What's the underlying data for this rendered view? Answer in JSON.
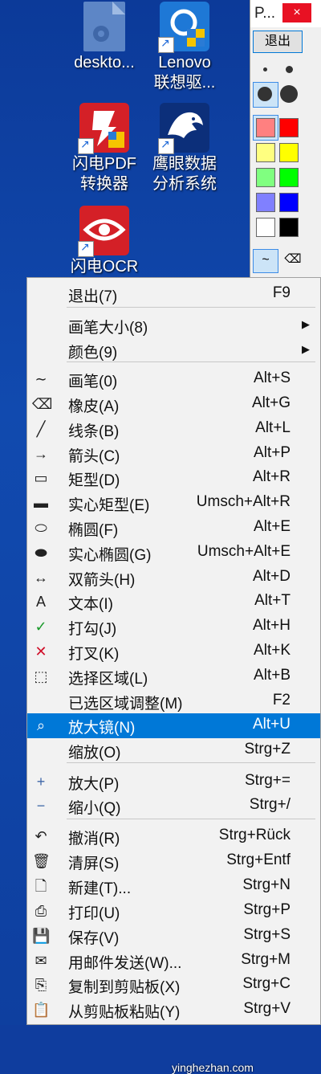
{
  "desktop_icons": [
    {
      "label_lines": [
        "deskto..."
      ],
      "icon": "config-file-icon"
    },
    {
      "label_lines": [
        "Lenovo",
        "联想驱..."
      ],
      "icon": "lenovo-driver-icon"
    },
    {
      "label_lines": [
        "闪电PDF",
        "转换器"
      ],
      "icon": "pdf-converter-icon"
    },
    {
      "label_lines": [
        "鹰眼数据",
        "分析系统"
      ],
      "icon": "eagle-icon"
    },
    {
      "label_lines": [
        "闪电OCR"
      ],
      "icon": "ocr-eye-icon"
    }
  ],
  "toolbar": {
    "title": "P...",
    "close_glyph": "×",
    "exit_label": "退出",
    "colors": [
      "#ff8080",
      "#ff0000",
      "#ffff80",
      "#ffff00",
      "#80ff80",
      "#00ff00",
      "#8080ff",
      "#0000ff",
      "#ffffff",
      "#000000"
    ]
  },
  "menu": {
    "items": [
      {
        "label": "退出(7)",
        "shortcut": "F9",
        "icon": ""
      },
      {
        "label": "画笔大小(8)",
        "shortcut": "",
        "submenu": true,
        "icon": ""
      },
      {
        "label": "颜色(9)",
        "shortcut": "",
        "submenu": true,
        "icon": ""
      },
      {
        "label": "画笔(0)",
        "shortcut": "Alt+S",
        "icon": "pen-icon"
      },
      {
        "label": "橡皮(A)",
        "shortcut": "Alt+G",
        "icon": "eraser-icon"
      },
      {
        "label": "线条(B)",
        "shortcut": "Alt+L",
        "icon": "line-icon"
      },
      {
        "label": "箭头(C)",
        "shortcut": "Alt+P",
        "icon": "arrow-icon"
      },
      {
        "label": "矩型(D)",
        "shortcut": "Alt+R",
        "icon": "rectangle-icon"
      },
      {
        "label": "实心矩型(E)",
        "shortcut": "Umsch+Alt+R",
        "icon": "filled-rectangle-icon"
      },
      {
        "label": "椭圆(F)",
        "shortcut": "Alt+E",
        "icon": "ellipse-icon"
      },
      {
        "label": "实心椭圆(G)",
        "shortcut": "Umsch+Alt+E",
        "icon": "filled-ellipse-icon"
      },
      {
        "label": "双箭头(H)",
        "shortcut": "Alt+D",
        "icon": "double-arrow-icon"
      },
      {
        "label": "文本(I)",
        "shortcut": "Alt+T",
        "icon": "text-icon"
      },
      {
        "label": "打勾(J)",
        "shortcut": "Alt+H",
        "icon": "checkmark-icon"
      },
      {
        "label": "打叉(K)",
        "shortcut": "Alt+K",
        "icon": "cross-icon"
      },
      {
        "label": "选择区域(L)",
        "shortcut": "Alt+B",
        "icon": "select-area-icon"
      },
      {
        "label": "已选区域调整(M)",
        "shortcut": "F2",
        "icon": ""
      },
      {
        "label": "放大镜(N)",
        "shortcut": "Alt+U",
        "icon": "magnifier-icon",
        "highlighted": true
      },
      {
        "label": "缩放(O)",
        "shortcut": "Strg+Z",
        "icon": ""
      },
      {
        "label": "放大(P)",
        "shortcut": "Strg+=",
        "icon": "plus-icon"
      },
      {
        "label": "缩小(Q)",
        "shortcut": "Strg+/",
        "icon": "minus-icon"
      },
      {
        "label": "撤消(R)",
        "shortcut": "Strg+Rück",
        "icon": "undo-icon"
      },
      {
        "label": "清屏(S)",
        "shortcut": "Strg+Entf",
        "icon": "trash-icon"
      },
      {
        "label": "新建(T)...",
        "shortcut": "Strg+N",
        "icon": "new-file-icon"
      },
      {
        "label": "打印(U)",
        "shortcut": "Strg+P",
        "icon": "printer-icon"
      },
      {
        "label": "保存(V)",
        "shortcut": "Strg+S",
        "icon": "save-icon"
      },
      {
        "label": "用邮件发送(W)...",
        "shortcut": "Strg+M",
        "icon": "mail-icon"
      },
      {
        "label": "复制到剪贴板(X)",
        "shortcut": "Strg+C",
        "icon": "copy-icon"
      },
      {
        "label": "从剪贴板粘贴(Y)",
        "shortcut": "Strg+V",
        "icon": "paste-icon"
      }
    ]
  },
  "watermark": "yinghezhan.com"
}
